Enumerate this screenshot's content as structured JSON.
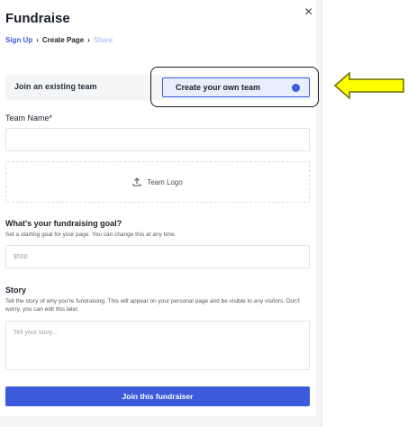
{
  "header": {
    "title": "Fundraise",
    "close_label": "×"
  },
  "breadcrumb": {
    "items": [
      "Sign Up",
      "Create Page",
      "Share"
    ],
    "separator": "›"
  },
  "team_choice": {
    "join_label": "Join an existing team",
    "create_label": "Create your own team",
    "selected": "create"
  },
  "team_name": {
    "label": "Team Name*",
    "value": "",
    "placeholder": ""
  },
  "team_logo": {
    "label": "Team Logo",
    "icon": "upload-icon"
  },
  "goal": {
    "label": "What's your fundraising goal?",
    "help": "Set a starting goal for your page. You can change this at any time.",
    "placeholder": "$500"
  },
  "story": {
    "label": "Story",
    "help": "Tell the story of why you're fundraising. This will appear on your personal page and be visible to any visitors. Don't worry, you can edit this later.",
    "placeholder": "Tell your story..."
  },
  "submit": {
    "label": "Join this fundraiser"
  },
  "colors": {
    "accent": "#3b5bdb",
    "annotation_arrow_fill": "#ffff00",
    "annotation_arrow_stroke": "#6b6b00"
  }
}
